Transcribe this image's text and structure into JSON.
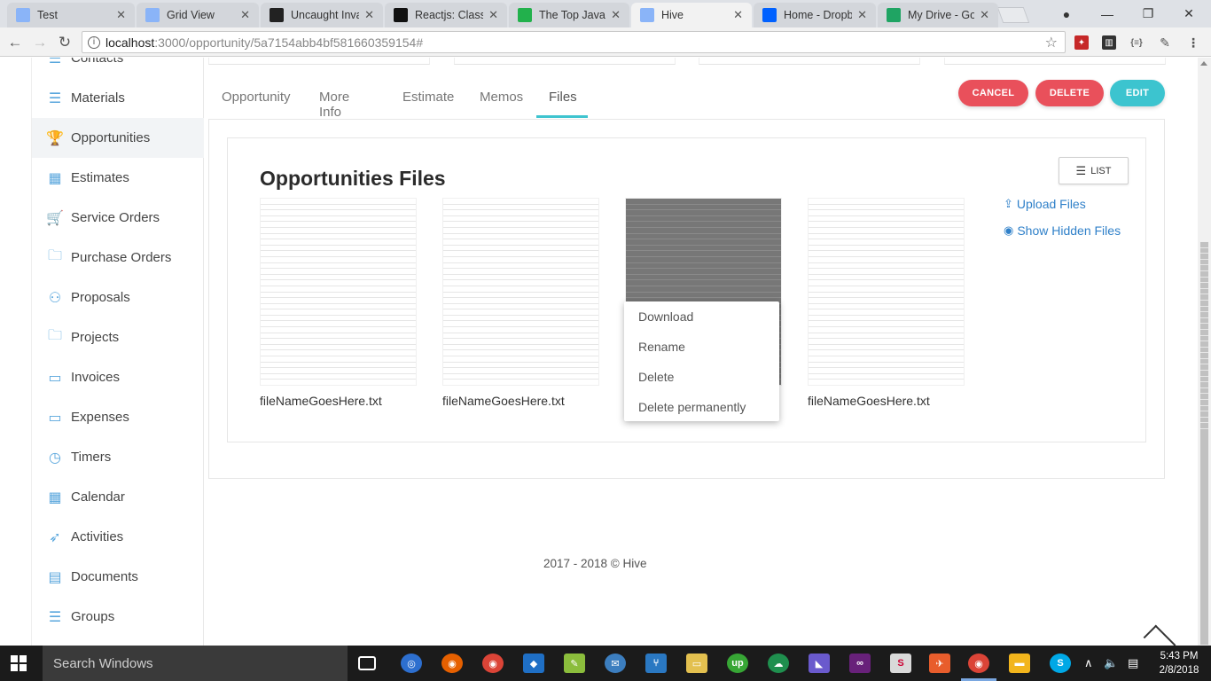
{
  "browser": {
    "tabs": [
      {
        "title": "Test",
        "icon": "document-icon",
        "color": "#8ab4f8"
      },
      {
        "title": "Grid View",
        "icon": "document-icon",
        "color": "#8ab4f8"
      },
      {
        "title": "Uncaught Inva",
        "icon": "github-icon",
        "color": "#222222"
      },
      {
        "title": "Reactjs: Class C",
        "icon": "medium-icon",
        "color": "#111111"
      },
      {
        "title": "The Top JavaSc",
        "icon": "clock-icon",
        "color": "#22b14c"
      },
      {
        "title": "Hive",
        "icon": "document-icon",
        "color": "#8ab4f8"
      },
      {
        "title": "Home - Dropb",
        "icon": "dropbox-icon",
        "color": "#0061ff"
      },
      {
        "title": "My Drive - Go",
        "icon": "drive-icon",
        "color": "#1fa463"
      }
    ],
    "active_tab_index": 5,
    "url_host": "localhost",
    "url_path": ":3000/opportunity/5a7154abb4bf581660359154#"
  },
  "sidebar": {
    "items": [
      {
        "label": "Contacts",
        "icon": "contacts-icon",
        "glyph": "☰"
      },
      {
        "label": "Materials",
        "icon": "list-icon",
        "glyph": "☰"
      },
      {
        "label": "Opportunities",
        "icon": "trophy-icon",
        "glyph": "🏆"
      },
      {
        "label": "Estimates",
        "icon": "calculator-icon",
        "glyph": "▦"
      },
      {
        "label": "Service Orders",
        "icon": "cart-icon",
        "glyph": "🛒"
      },
      {
        "label": "Purchase Orders",
        "icon": "folder-icon",
        "glyph": "🗀"
      },
      {
        "label": "Proposals",
        "icon": "badge-icon",
        "glyph": "⚇"
      },
      {
        "label": "Projects",
        "icon": "folder-icon",
        "glyph": "🗀"
      },
      {
        "label": "Invoices",
        "icon": "card-icon",
        "glyph": "▭"
      },
      {
        "label": "Expenses",
        "icon": "card-icon",
        "glyph": "▭"
      },
      {
        "label": "Timers",
        "icon": "clock-icon",
        "glyph": "◷"
      },
      {
        "label": "Calendar",
        "icon": "calendar-icon",
        "glyph": "▦"
      },
      {
        "label": "Activities",
        "icon": "rocket-icon",
        "glyph": "➶"
      },
      {
        "label": "Documents",
        "icon": "document-icon",
        "glyph": "▤"
      },
      {
        "label": "Groups",
        "icon": "list-icon",
        "glyph": "☰"
      }
    ],
    "active": "Opportunities"
  },
  "page_tabs": [
    "Opportunity",
    "More Info",
    "Estimate",
    "Memos",
    "Files"
  ],
  "active_page_tab": "Files",
  "actions": {
    "cancel": "CANCEL",
    "delete": "DELETE",
    "edit": "EDIT"
  },
  "colors": {
    "cancel": "#e9505b",
    "delete": "#e9505b",
    "edit": "#3cc4cf",
    "accent": "#3fc4cf",
    "link": "#2f80c9"
  },
  "files_section": {
    "title": "Opportunities Files",
    "list_button": "LIST",
    "upload_link": "Upload Files",
    "hidden_link": "Show Hidden Files",
    "files": [
      {
        "name": "fileNameGoesHere.txt"
      },
      {
        "name": "fileNameGoesHere.txt"
      },
      {
        "name": ""
      },
      {
        "name": "fileNameGoesHere.txt"
      }
    ]
  },
  "context_menu": [
    "Download",
    "Rename",
    "Delete",
    "Delete permanently"
  ],
  "footer": "2017 - 2018 © Hive",
  "taskbar": {
    "search_placeholder": "Search Windows",
    "time": "5:43 PM",
    "date": "2/8/2018"
  }
}
